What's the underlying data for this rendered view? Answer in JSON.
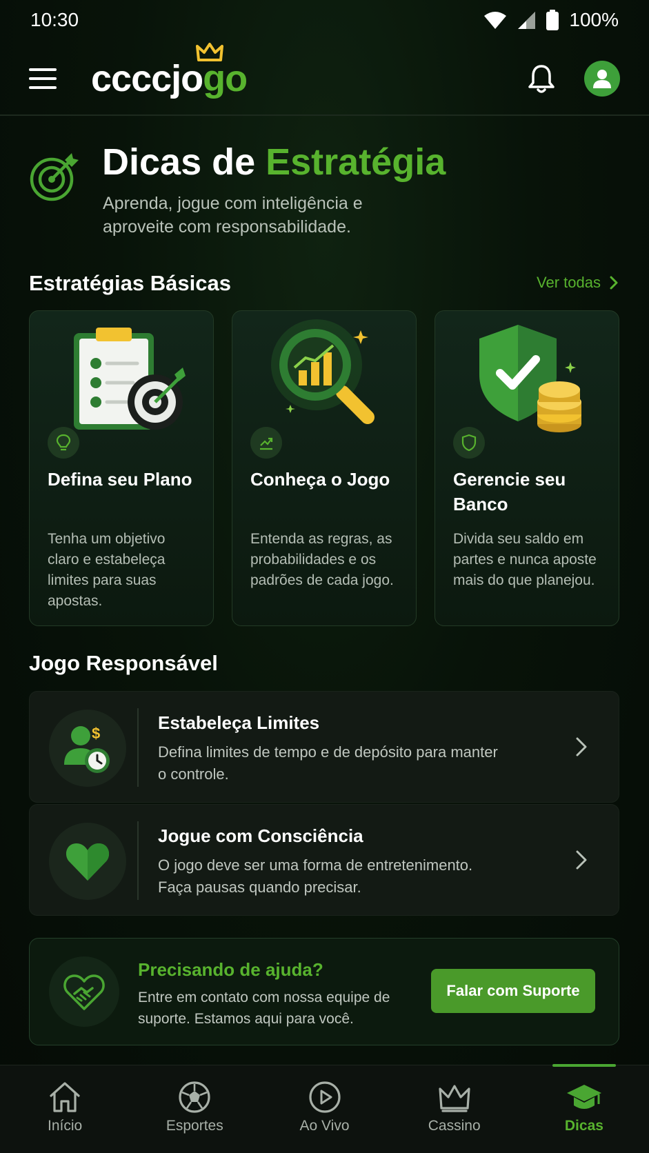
{
  "status_bar": {
    "time": "10:30",
    "battery": "100%"
  },
  "header": {
    "logo_part1": "ccccjo",
    "logo_part2": "go"
  },
  "hero": {
    "title_part1": "Dicas de ",
    "title_part2": "Estratégia",
    "subtitle": "Aprenda, jogue com inteligência e aproveite com responsabilidade."
  },
  "strategies": {
    "title": "Estratégias Básicas",
    "see_all": "Ver todas",
    "cards": [
      {
        "title": "Defina seu Plano",
        "description": "Tenha um objetivo claro e estabeleça limites para suas apostas.",
        "badge_icon": "lightbulb-icon"
      },
      {
        "title": "Conheça o Jogo",
        "description": "Entenda as regras, as probabilidades e os padrões de cada jogo.",
        "badge_icon": "trend-chart-icon"
      },
      {
        "title": "Gerencie seu Banco",
        "description": "Divida seu saldo em partes e nunca aposte mais do que planejou.",
        "badge_icon": "shield-icon"
      }
    ]
  },
  "responsible": {
    "title": "Jogo Responsável",
    "items": [
      {
        "title": "Estabeleça Limites",
        "description": "Defina limites de tempo e de depósito para manter o controle.",
        "icon": "user-clock-icon"
      },
      {
        "title": "Jogue com Consciência",
        "description": "O jogo deve ser uma forma de entretenimento. Faça pausas quando precisar.",
        "icon": "heart-icon"
      }
    ]
  },
  "help": {
    "title": "Precisando de ajuda?",
    "description": "Entre em contato com nossa equipe de suporte. Estamos aqui para você.",
    "button": "Falar com Suporte"
  },
  "bottom_nav": {
    "items": [
      {
        "label": "Início",
        "icon": "home-icon",
        "active": false
      },
      {
        "label": "Esportes",
        "icon": "soccer-ball-icon",
        "active": false
      },
      {
        "label": "Ao Vivo",
        "icon": "play-circle-icon",
        "active": false
      },
      {
        "label": "Cassino",
        "icon": "crown-icon",
        "active": false
      },
      {
        "label": "Dicas",
        "icon": "graduation-cap-icon",
        "active": true
      }
    ]
  },
  "colors": {
    "accent": "#58b32e",
    "button": "#4a9a2a",
    "background": "#071008",
    "gold": "#f2c230"
  }
}
